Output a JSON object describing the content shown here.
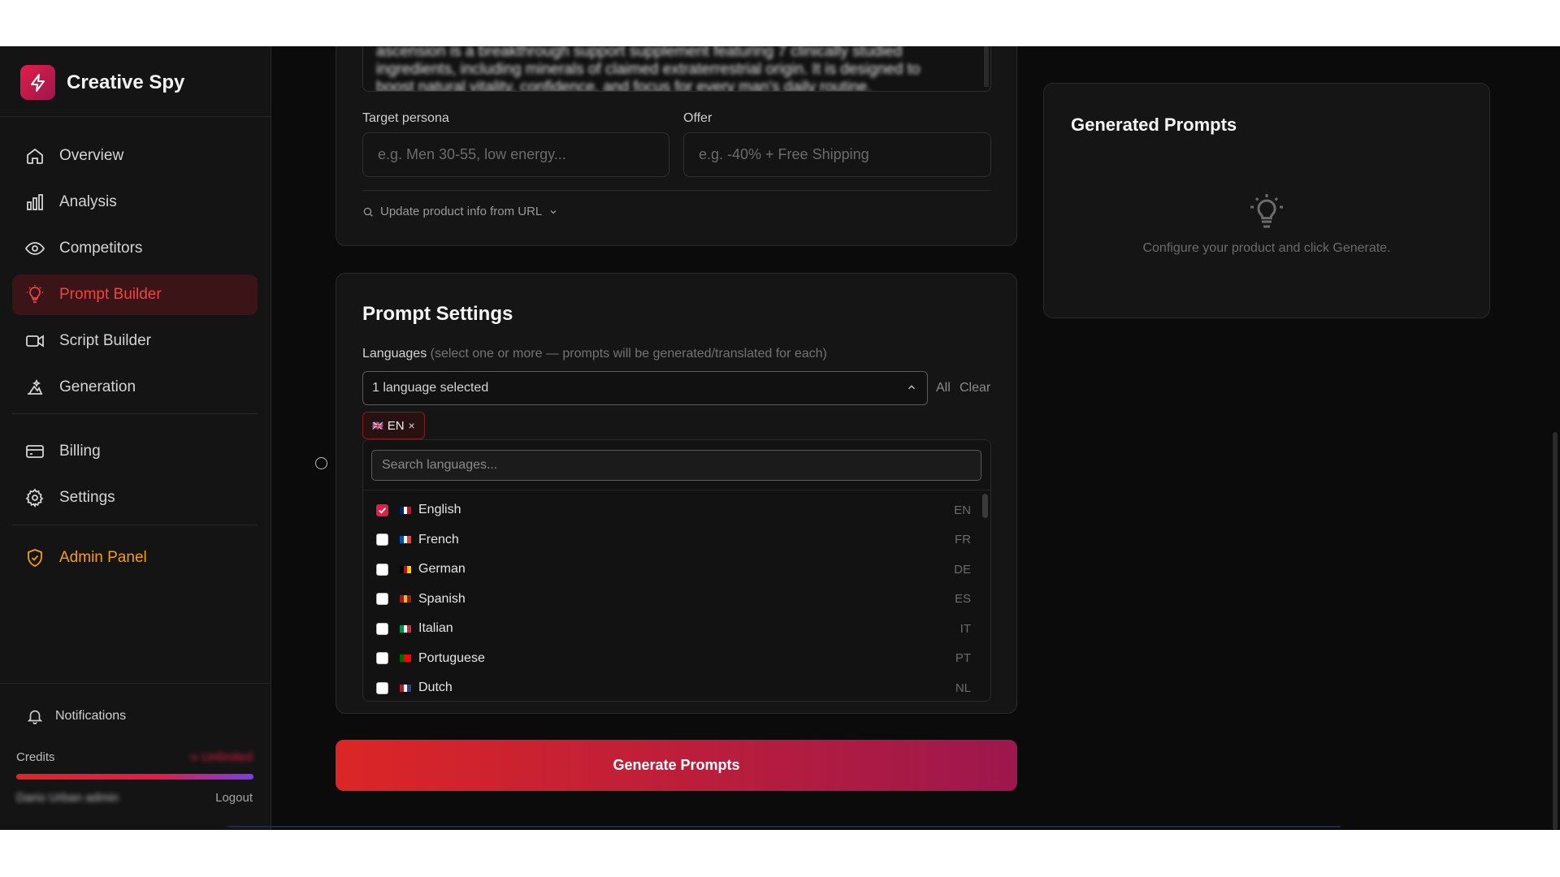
{
  "app": {
    "name": "Creative Spy",
    "brand_color": "#e11d48"
  },
  "sidebar": {
    "items": [
      {
        "label": "Overview",
        "icon": "home-icon"
      },
      {
        "label": "Analysis",
        "icon": "bar-chart-icon"
      },
      {
        "label": "Competitors",
        "icon": "eye-icon"
      },
      {
        "label": "Prompt Builder",
        "icon": "lightbulb-icon",
        "active": true
      },
      {
        "label": "Script Builder",
        "icon": "video-icon"
      },
      {
        "label": "Generation",
        "icon": "image-gen-icon"
      },
      {
        "label": "Billing",
        "icon": "credit-card-icon"
      },
      {
        "label": "Settings",
        "icon": "gear-icon"
      },
      {
        "label": "Admin Panel",
        "icon": "shield-check-icon"
      }
    ],
    "notifications": "Notifications",
    "credits_label": "Credits",
    "credits_value": "∞ Unlimited",
    "user_name": "Dario Urban admin",
    "logout": "Logout"
  },
  "product": {
    "description_text": "ascension is a breakthrough support supplement featuring 7 clinically studied ingredients, including minerals of claimed extraterrestrial origin. It is designed to boost natural vitality, confidence, and focus for every man's daily routine.",
    "target_persona_label": "Target persona",
    "target_persona_placeholder": "e.g. Men 30-55, low energy...",
    "offer_label": "Offer",
    "offer_placeholder": "e.g. -40% + Free Shipping",
    "update_url_label": "Update product info from URL"
  },
  "prompt_settings": {
    "title": "Prompt Settings",
    "languages_label": "Languages",
    "languages_hint": "(select one or more — prompts will be generated/translated for each)",
    "select_value": "1 language selected",
    "all_label": "All",
    "clear_label": "Clear",
    "chip_flag": "🇬🇧",
    "chip_code": "EN",
    "chip_remove": "×",
    "search_placeholder": "Search languages...",
    "languages": [
      {
        "name": "English",
        "code": "EN",
        "checked": true,
        "flag": [
          "#012169",
          "#ffffff",
          "#c8102e"
        ]
      },
      {
        "name": "French",
        "code": "FR",
        "checked": false,
        "flag": [
          "#0055a4",
          "#ffffff",
          "#ef4135"
        ]
      },
      {
        "name": "German",
        "code": "DE",
        "checked": false,
        "flag": [
          "#000000",
          "#dd0000",
          "#ffce00"
        ]
      },
      {
        "name": "Spanish",
        "code": "ES",
        "checked": false,
        "flag": [
          "#aa151b",
          "#f1bf00",
          "#aa151b"
        ]
      },
      {
        "name": "Italian",
        "code": "IT",
        "checked": false,
        "flag": [
          "#009246",
          "#ffffff",
          "#ce2b37"
        ]
      },
      {
        "name": "Portuguese",
        "code": "PT",
        "checked": false,
        "flag": [
          "#006600",
          "#ff0000",
          "#ff0000"
        ]
      },
      {
        "name": "Dutch",
        "code": "NL",
        "checked": false,
        "flag": [
          "#ae1c28",
          "#ffffff",
          "#21468b"
        ]
      }
    ]
  },
  "generate_button": "Generate Prompts",
  "generated": {
    "title": "Generated Prompts",
    "empty_text": "Configure your product and click Generate."
  }
}
